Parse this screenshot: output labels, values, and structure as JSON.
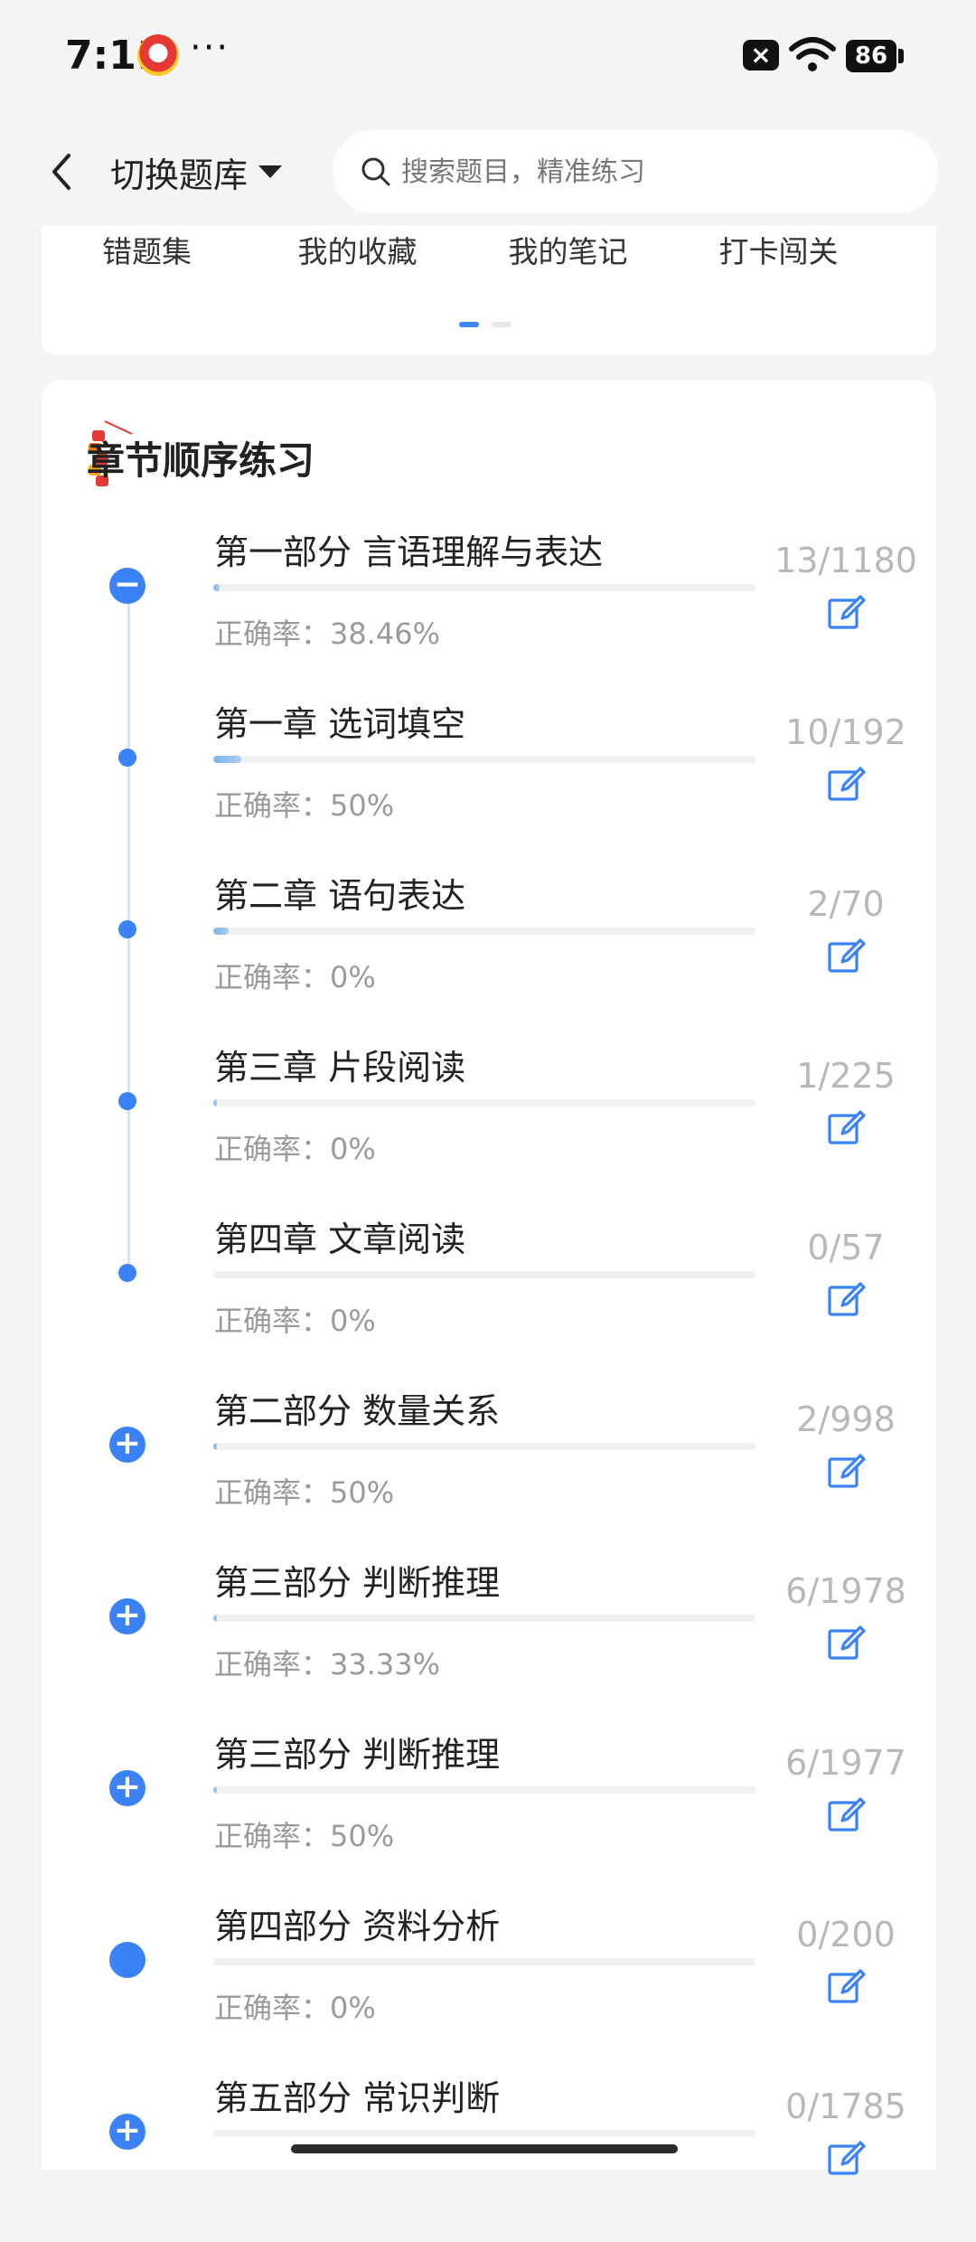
{
  "status_bar": {
    "time": "7:11",
    "more": "···",
    "notification_x": "×",
    "battery": "86"
  },
  "header": {
    "switch_bank_label": "切换题库",
    "search_placeholder": "搜索题目，精准练习"
  },
  "quick_links": [
    "错题集",
    "我的收藏",
    "我的笔记",
    "打卡闯关"
  ],
  "section": {
    "title": "章节顺序练习"
  },
  "accuracy_prefix": "正确率：",
  "rows": [
    {
      "title": "第一部分 言语理解与表达",
      "accuracy": "38.46%",
      "count": "13/1180",
      "progress": 0.011,
      "node": "minus"
    },
    {
      "title": "第一章 选词填空",
      "accuracy": "50%",
      "count": "10/192",
      "progress": 0.052,
      "node": "dot"
    },
    {
      "title": "第二章 语句表达",
      "accuracy": "0%",
      "count": "2/70",
      "progress": 0.029,
      "node": "dot"
    },
    {
      "title": "第三章 片段阅读",
      "accuracy": "0%",
      "count": "1/225",
      "progress": 0.004,
      "node": "dot"
    },
    {
      "title": "第四章 文章阅读",
      "accuracy": "0%",
      "count": "0/57",
      "progress": 0,
      "node": "dot"
    },
    {
      "title": "第二部分 数量关系",
      "accuracy": "50%",
      "count": "2/998",
      "progress": 0.002,
      "node": "plus"
    },
    {
      "title": "第三部分 判断推理",
      "accuracy": "33.33%",
      "count": "6/1978",
      "progress": 0.003,
      "node": "plus"
    },
    {
      "title": "第三部分 判断推理",
      "accuracy": "50%",
      "count": "6/1977",
      "progress": 0.003,
      "node": "plus"
    },
    {
      "title": "第四部分 资料分析",
      "accuracy": "0%",
      "count": "0/200",
      "progress": 0,
      "node": "filled"
    },
    {
      "title": "第五部分 常识判断",
      "accuracy": "",
      "count": "0/1785",
      "progress": 0,
      "node": "plus"
    }
  ],
  "colors": {
    "accent": "#3b82f6",
    "timeline": "#cfe2fb",
    "count_text": "#b8b8b8"
  }
}
